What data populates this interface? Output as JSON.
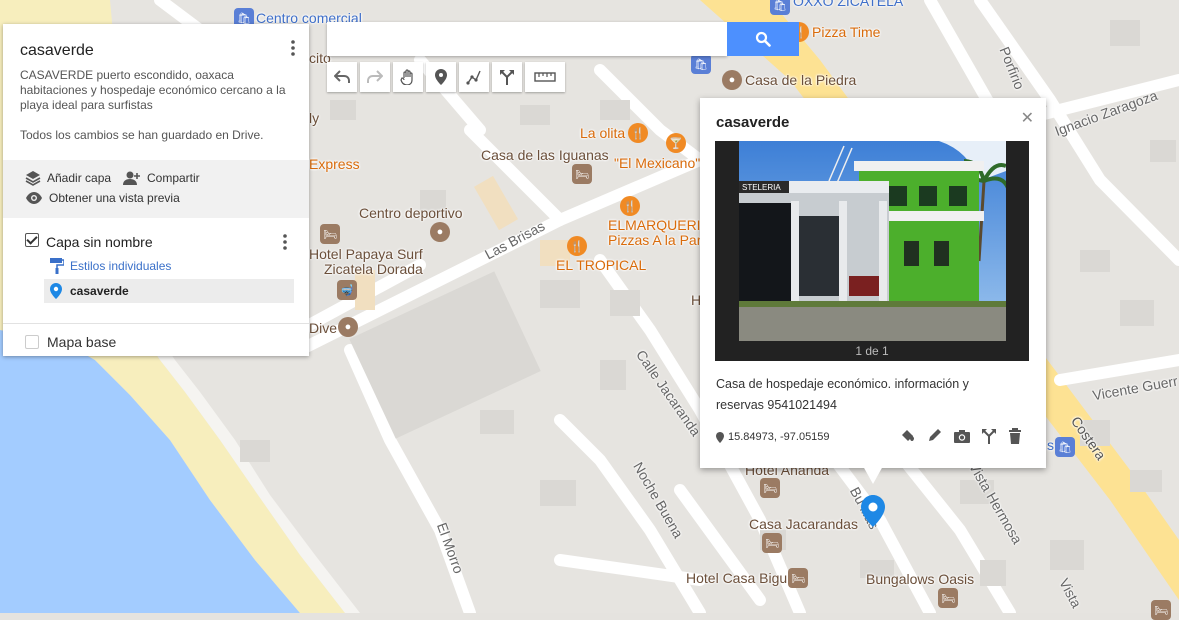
{
  "map": {
    "labels": {
      "centro_comercial": "Centro comercial",
      "oxxo": "OXXO ZICATELA",
      "pizza_time": "Pizza Time",
      "casa_piedra": "Casa de la Piedra",
      "la_olita": "La olita",
      "casa_iguanas": "Casa de las Iguanas",
      "el_mexicano": "\"El Mexicano\"",
      "express": "Express",
      "centro_deportivo": "Centro deportivo",
      "elmarquerido": "ELMARQUERIDO",
      "pizzas_a_la_par": "Pizzas A la Par",
      "el_tropical": "EL TROPICAL",
      "hotel_papaya": "Hotel Papaya Surf",
      "zicatela_dorada": "Zicatela Dorada",
      "dive": "Dive",
      "ly": "ly",
      "ecito": "cito",
      "h_partial": "H",
      "hotel_ananda": "Hotel Ananda",
      "casa_jacarandas": "Casa Jacarandas",
      "hotel_casa_bigu": "Hotel Casa Bigu",
      "bungalows_oasis": "Bungalows Oasis",
      "s_partial": "s",
      "c_partial": "C"
    },
    "roads": {
      "las_brisas": "Las Brisas",
      "calle_jacaranda": "Calle Jacaranda",
      "noche_buena": "Noche Buena",
      "el_morro": "El Morro",
      "porfirio": "Porfirio",
      "ignacio_zaragoza": "Ignacio Zaragoza",
      "vicente_guerr": "Vicente Guerr",
      "costera": "Costera",
      "vista_hermosa": "Vista Hermosa",
      "bu_illas": "Bu    illas",
      "vista_partial": "Vista"
    }
  },
  "panel": {
    "title": "casaverde",
    "description": "CASAVERDE puerto escondido, oaxaca habitaciones y hospedaje económico cercano a la playa ideal para surfistas",
    "saved_status": "Todos los cambios se han guardado en Drive.",
    "add_layer": "Añadir capa",
    "share": "Compartir",
    "preview": "Obtener una vista previa",
    "layer_name": "Capa sin nombre",
    "layer_style": "Estilos individuales",
    "layer_item": "casaverde",
    "base_map": "Mapa base"
  },
  "search": {
    "value": "",
    "placeholder": ""
  },
  "toolbar": {
    "icons": [
      "undo-icon",
      "redo-icon",
      "hand-icon",
      "marker-icon",
      "draw-line-icon",
      "directions-icon",
      "ruler-icon"
    ]
  },
  "popup": {
    "title": "casaverde",
    "photo_count": "1 de 1",
    "description": "Casa de hospedaje económico. información y reservas 9541021494",
    "coordinates": "15.84973, -97.05159",
    "photo_sign": "STELERIA"
  },
  "colors": {
    "accent": "#4d90fe",
    "water": "#a3ccff",
    "beach": "#f7eebd",
    "highway": "#fde293",
    "pin": "#1e88e5"
  }
}
